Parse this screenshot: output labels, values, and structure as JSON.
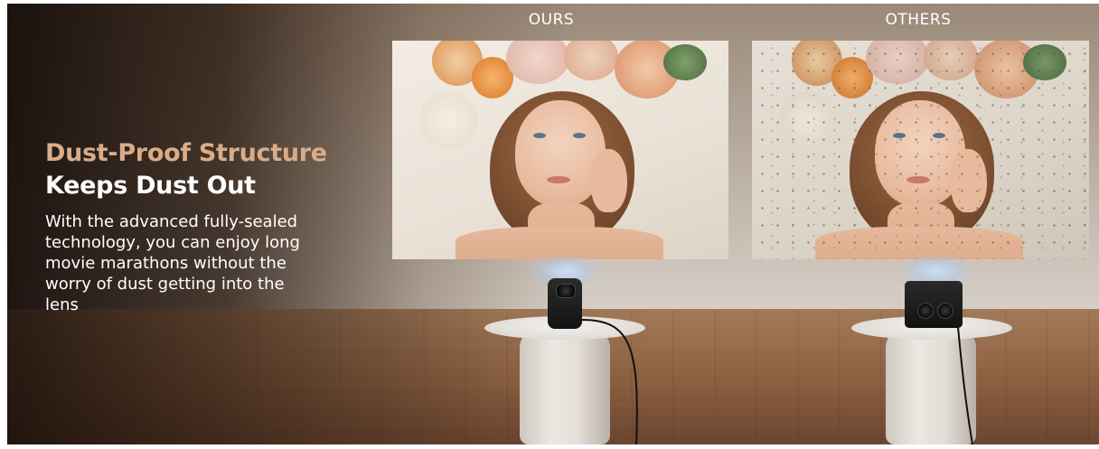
{
  "labels": {
    "ours": "OURS",
    "others": "OTHERS"
  },
  "headline": {
    "accent": "Dust-Proof Structure",
    "main": "Keeps Dust Out"
  },
  "body": {
    "line1": "With the advanced fully-sealed",
    "line2": "technology, you can enjoy long",
    "line3": "movie marathons without the",
    "line4": "worry of dust getting into the",
    "line5": "lens"
  },
  "colors": {
    "accent": "#d9ac88",
    "text": "#ffffff"
  }
}
